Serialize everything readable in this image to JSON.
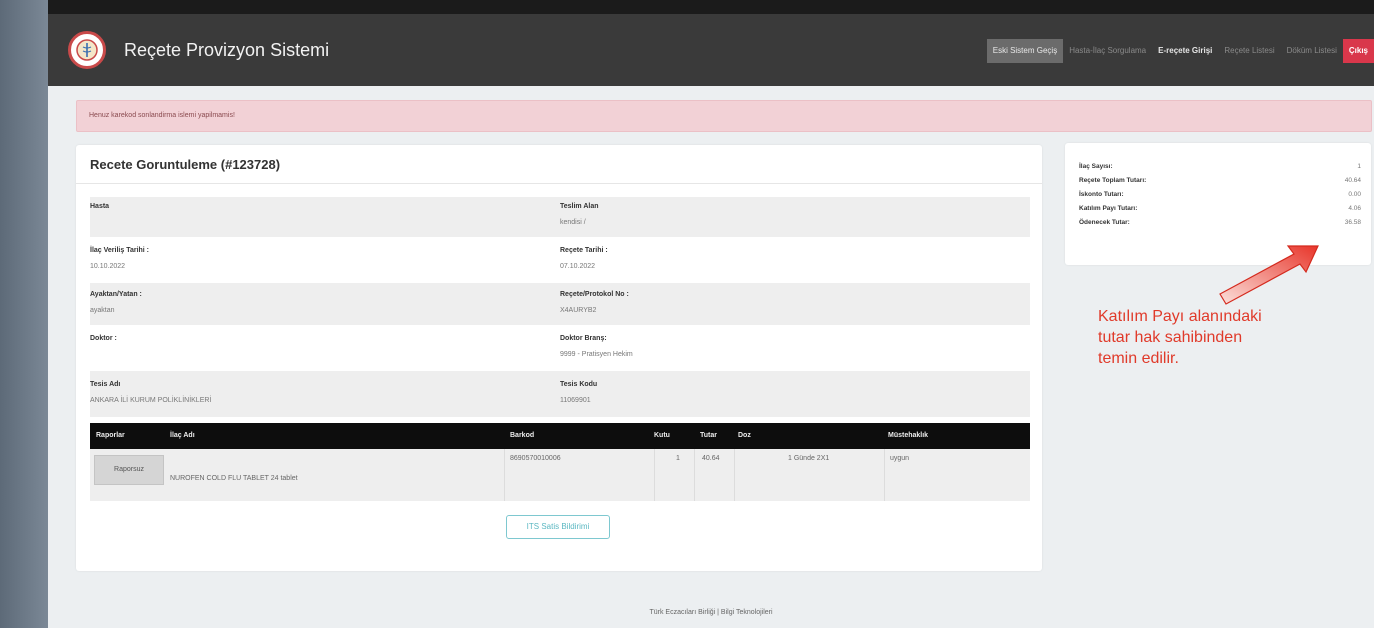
{
  "app": {
    "brand": "Reçete Provizyon Sistemi"
  },
  "nav": {
    "items": [
      {
        "label": "Eski Sistem Geçiş",
        "style": "active"
      },
      {
        "label": "Hasta-İlaç Sorgulama",
        "style": "dim"
      },
      {
        "label": "E-reçete Girişi",
        "style": "bright"
      },
      {
        "label": "Reçete Listesi",
        "style": "dim"
      },
      {
        "label": "Döküm Listesi",
        "style": "dim"
      },
      {
        "label": "Çıkış",
        "style": "danger"
      }
    ]
  },
  "alert": {
    "text": "Henuz karekod sonlandirma islemi yapilmamis!"
  },
  "prescription": {
    "title": "Recete Goruntuleme (#123728)",
    "fields": {
      "hasta_label": "Hasta",
      "hasta_value": "",
      "teslim_label": "Teslim Alan",
      "teslim_value": "kendisi /",
      "verilis_label": "İlaç Veriliş Tarihi :",
      "verilis_value": "10.10.2022",
      "recete_tarihi_label": "Reçete Tarihi :",
      "recete_tarihi_value": "07.10.2022",
      "ayaktan_label": "Ayaktan/Yatan :",
      "ayaktan_value": "ayaktan",
      "protokol_label": "Reçete/Protokol No :",
      "protokol_value": "X4AURYB2",
      "doktor_label": "Doktor :",
      "doktor_value": "",
      "brans_label": "Doktor Branş:",
      "brans_value": "9999 - Pratisyen Hekim",
      "tesis_adi_label": "Tesis Adı",
      "tesis_adi_value": "ANKARA İLİ KURUM POLİKLİNİKLERİ",
      "tesis_kodu_label": "Tesis Kodu",
      "tesis_kodu_value": "11069901"
    },
    "table": {
      "headers": [
        "Raporlar",
        "İlaç Adı",
        "Barkod",
        "Kutu",
        "Tutar",
        "Doz",
        "Müstehaklık"
      ],
      "rows": [
        {
          "rapor": "Raporsuz",
          "ilac_adi": "NUROFEN COLD FLU TABLET 24 tablet",
          "barkod": "8690570010006",
          "kutu": "1",
          "tutar": "40.64",
          "doz": "1 Günde 2X1",
          "mustehaklik": "uygun"
        }
      ]
    },
    "its_button": "ITS Satis Bildirimi"
  },
  "summary": {
    "rows": [
      {
        "label": "İlaç Sayısı:",
        "value": "1"
      },
      {
        "label": "Reçete Toplam Tutarı:",
        "value": "40.64"
      },
      {
        "label": "İskonto Tutarı:",
        "value": "0.00"
      },
      {
        "label": "Katılım Payı Tutarı:",
        "value": "4.06"
      },
      {
        "label": "Ödenecek Tutar:",
        "value": "36.58"
      }
    ]
  },
  "annotation": {
    "lines": [
      "Katılım Payı alanındaki",
      "tutar hak sahibinden",
      "temin edilir."
    ],
    "color": "#e03a2a"
  },
  "footer": {
    "text": "Türk Eczacıları Birliği | Bilgi Teknolojileri"
  },
  "colors": {
    "navbar": "#3a3a3a",
    "danger": "#d9374b",
    "alert_bg": "#f2d1d6",
    "table_head": "#0d0d0d",
    "its_accent": "#5bb8c2"
  }
}
